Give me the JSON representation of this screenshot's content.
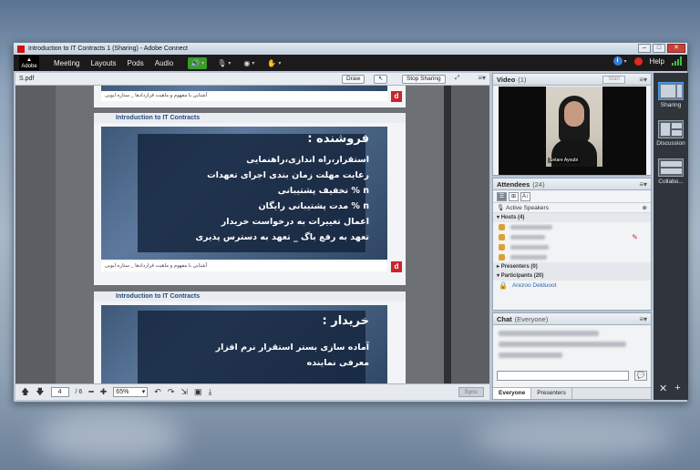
{
  "window": {
    "title": "Introduction to IT Contracts 1 (Sharing) - Adobe Connect"
  },
  "menubar": {
    "logo": "Adobe",
    "items": [
      "Meeting",
      "Layouts",
      "Pods",
      "Audio"
    ],
    "help": "Help"
  },
  "share_pod": {
    "title": "S.pdf",
    "draw_label": "Draw",
    "stop_sharing_label": "Stop Sharing",
    "slide1": {
      "tab": "Introduction to IT Contracts",
      "heading": "فروشنده :",
      "lines": [
        "استقرار،راه اندازی،راهنمایی",
        "رعایت مهلت زمان بندی اجرای تعهدات",
        "n % تخفیف پشتیبانی",
        "n % مدت پشتیبانی رایگان",
        "اعمال تغییرات به درخواست خریدار",
        "تعهد به رفع باگ _ تعهد به دسترس پذیری"
      ],
      "footer": "آشنایی با مفهوم و ماهیت قراردادها _ ستاره ایوبی"
    },
    "slide2": {
      "tab": "Introduction to IT Contracts",
      "heading": "خریدار :",
      "lines": [
        "آماده سازی بستر استقرار نرم افزار",
        "معرفی نماینده"
      ]
    },
    "top_slide_footer": "آشنایی با مفهوم و ماهیت قراردادها _ ستاره ایوبی",
    "logo_letter": "d",
    "toolbar": {
      "page": "4",
      "total": "/ 6",
      "zoom": "65%",
      "sync": "Sync"
    }
  },
  "video_pod": {
    "title": "Video",
    "count": "(1)",
    "start_label": "Start",
    "camera_name": "Setare Ayoubi"
  },
  "attendees_pod": {
    "title": "Attendees",
    "count": "(24)",
    "active_speakers": "Active Speakers",
    "hosts_label": "Hosts (4)",
    "presenters_label": "Presenters (0)",
    "participants_label": "Participants (20)",
    "first_participant": "Arezoo Delduoot"
  },
  "chat_pod": {
    "title": "Chat",
    "subtitle": "(Everyone)",
    "tabs": [
      "Everyone",
      "Presenters"
    ]
  },
  "layouts": {
    "items": [
      "Sharing",
      "Discussion",
      "Collabo..."
    ]
  },
  "colors": {
    "menubar": "#1b1b1b",
    "accent": "#3a9a2a",
    "logo_red": "#c8262b"
  }
}
